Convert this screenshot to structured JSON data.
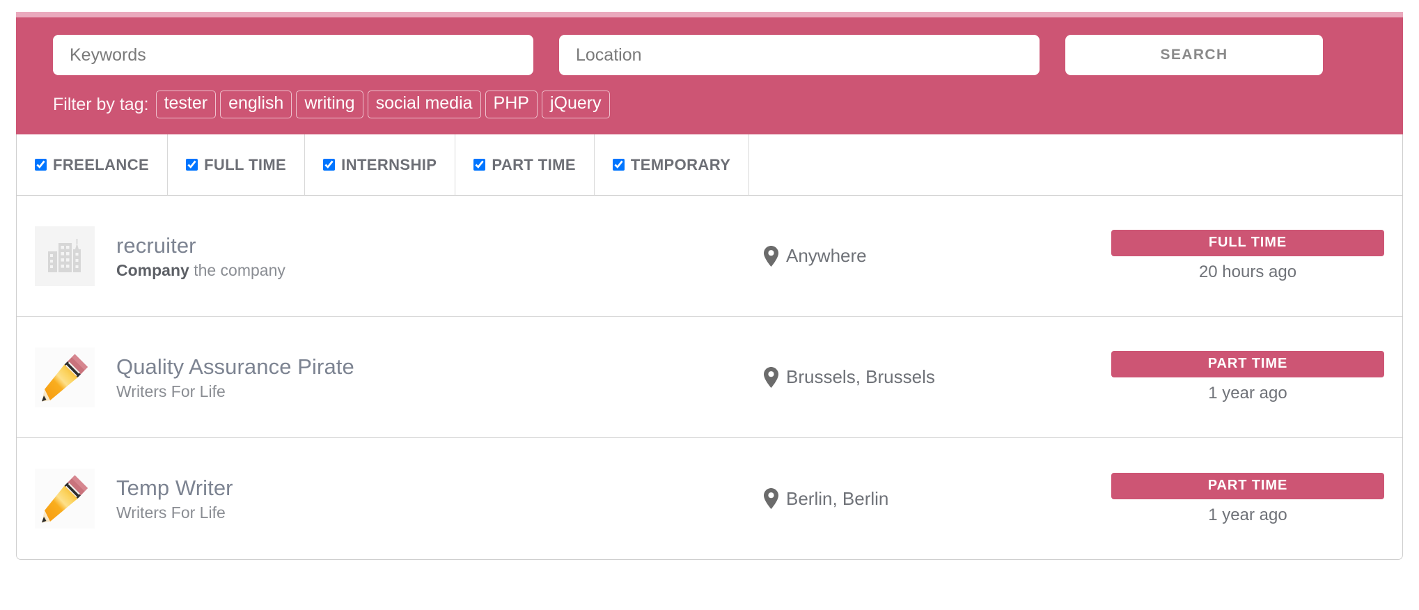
{
  "theme": {
    "accent": "#cd5574",
    "accent_light": "#eaa9bd",
    "text_gray": "#6f7278",
    "title_gray": "#7c8391",
    "border_gray": "#cfcfcf"
  },
  "search": {
    "keywords_placeholder": "Keywords",
    "keywords_value": "",
    "location_placeholder": "Location",
    "location_value": "",
    "search_button_label": "SEARCH"
  },
  "tag_filter": {
    "label": "Filter by tag:",
    "tags": [
      {
        "label": "tester"
      },
      {
        "label": "english"
      },
      {
        "label": "writing"
      },
      {
        "label": "social media"
      },
      {
        "label": "PHP"
      },
      {
        "label": "jQuery"
      }
    ]
  },
  "job_type_filters": [
    {
      "label": "FREELANCE",
      "checked": true,
      "name": "freelance"
    },
    {
      "label": "FULL TIME",
      "checked": true,
      "name": "full-time"
    },
    {
      "label": "INTERNSHIP",
      "checked": true,
      "name": "internship"
    },
    {
      "label": "PART TIME",
      "checked": true,
      "name": "part-time"
    },
    {
      "label": "TEMPORARY",
      "checked": true,
      "name": "temporary"
    }
  ],
  "listings": [
    {
      "title": "recruiter",
      "company_label": "Company",
      "company_name": "the company",
      "location": "Anywhere",
      "job_type": "FULL TIME",
      "posted": "20 hours ago",
      "logo": "building-placeholder-icon"
    },
    {
      "title": "Quality Assurance Pirate",
      "company_label": "",
      "company_name": "Writers For Life",
      "location": "Brussels, Brussels",
      "job_type": "PART TIME",
      "posted": "1 year ago",
      "logo": "pencil-icon"
    },
    {
      "title": "Temp Writer",
      "company_label": "",
      "company_name": "Writers For Life",
      "location": "Berlin, Berlin",
      "job_type": "PART TIME",
      "posted": "1 year ago",
      "logo": "pencil-icon"
    }
  ]
}
